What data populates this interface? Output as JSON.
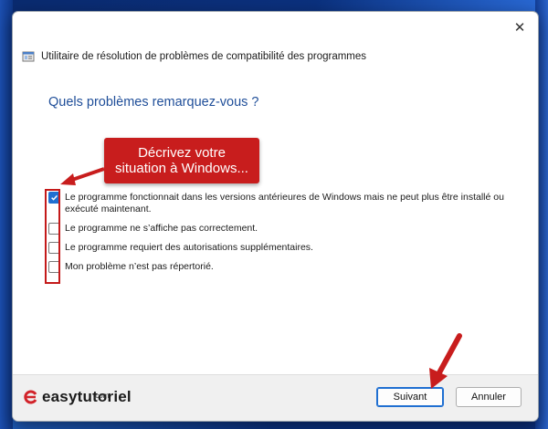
{
  "window": {
    "title": "Utilitaire de résolution de problèmes de compatibilité des programmes",
    "close_glyph": "✕"
  },
  "page": {
    "heading": "Quels problèmes remarquez-vous ?",
    "options": [
      {
        "label": "Le programme fonctionnait dans les versions antérieures de Windows mais ne peut plus être installé ou exécuté maintenant.",
        "checked": true
      },
      {
        "label": "Le programme ne s’affiche pas correctement.",
        "checked": false
      },
      {
        "label": "Le programme requiert des autorisations supplémentaires.",
        "checked": false
      },
      {
        "label": "Mon problème n’est pas répertorié.",
        "checked": false
      }
    ]
  },
  "annotation": {
    "callout_line1": "Décrivez votre",
    "callout_line2": "situation à Windows...",
    "color": "#c81d1d"
  },
  "footer": {
    "brand": "easytutoriel",
    "brand_sub": ".com",
    "next_label": "Suivant",
    "cancel_label": "Annuler"
  },
  "colors": {
    "accent": "#1f6fd1",
    "heading": "#1f4e99",
    "wallpaper": "#0c3a94"
  }
}
